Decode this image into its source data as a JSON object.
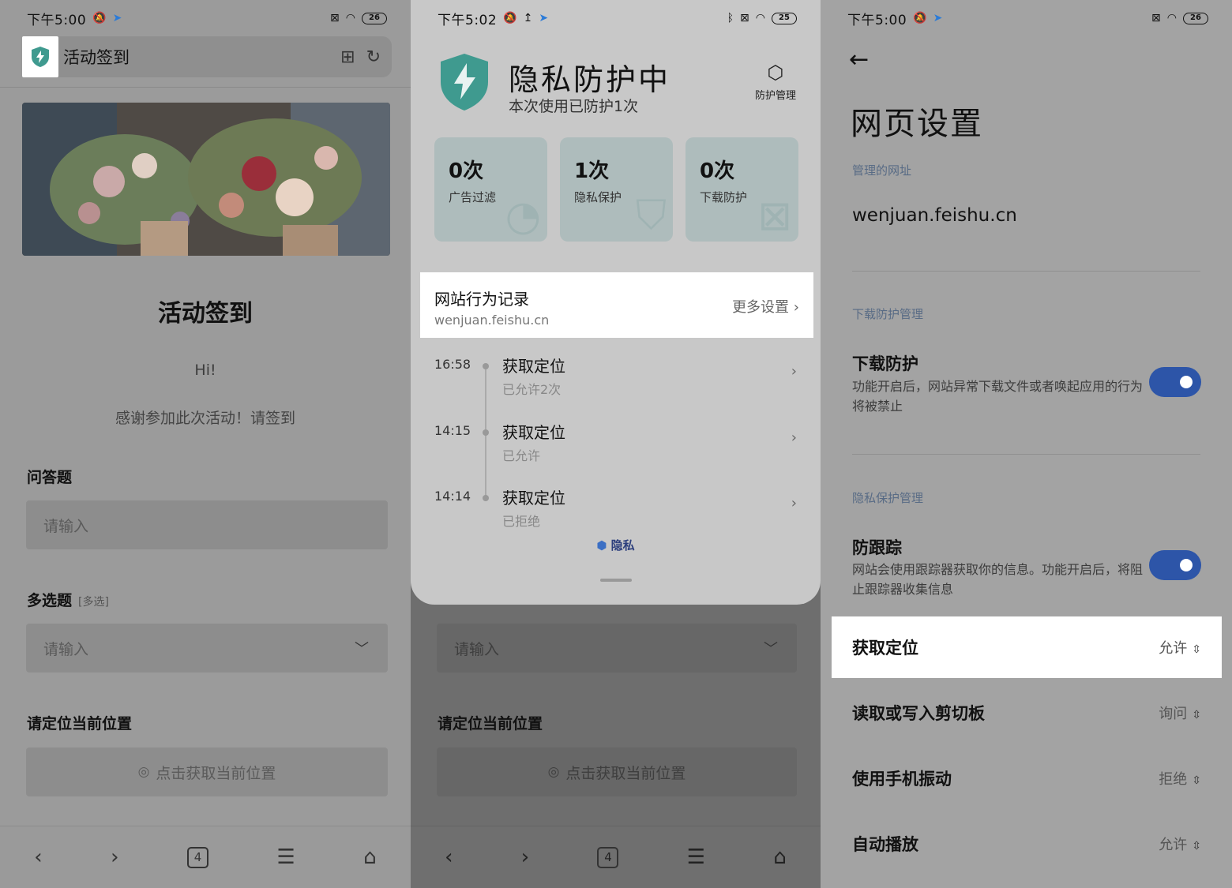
{
  "panel1": {
    "status": {
      "time": "下午5:00",
      "battery": "26"
    },
    "url_title": "活动签到",
    "heading": "活动签到",
    "greeting": "Hi!",
    "thanks": "感谢参加此次活动！请签到",
    "q1_label": "问答题",
    "q1_placeholder": "请输入",
    "q2_label": "多选题",
    "q2_tag": "[多选]",
    "q2_placeholder": "请输入",
    "q3_label": "请定位当前位置",
    "q3_button": "点击获取当前位置",
    "tab_count": "4"
  },
  "panel2": {
    "status": {
      "time": "下午5:02",
      "battery": "25"
    },
    "title": "隐私防护中",
    "subtitle": "本次使用已防护1次",
    "manage": "防护管理",
    "stats": [
      {
        "num": "0次",
        "label": "广告过滤"
      },
      {
        "num": "1次",
        "label": "隐私保护"
      },
      {
        "num": "0次",
        "label": "下载防护"
      }
    ],
    "record_title": "网站行为记录",
    "record_url": "wenjuan.feishu.cn",
    "record_more": "更多设置",
    "records": [
      {
        "time": "16:58",
        "name": "获取定位",
        "status": "已允许2次"
      },
      {
        "time": "14:15",
        "name": "获取定位",
        "status": "已允许"
      },
      {
        "time": "14:14",
        "name": "获取定位",
        "status": "已拒绝"
      }
    ],
    "brand": "隐私",
    "bg_q2_placeholder": "请输入",
    "bg_q3_label": "请定位当前位置",
    "bg_q3_button": "点击获取当前位置",
    "tab_count": "4"
  },
  "panel3": {
    "status": {
      "time": "下午5:00",
      "battery": "26"
    },
    "title": "网页设置",
    "managed_url_label": "管理的网址",
    "managed_url": "wenjuan.feishu.cn",
    "download_section": "下载防护管理",
    "download_title": "下载防护",
    "download_desc": "功能开启后，网站异常下载文件或者唤起应用的行为将被禁止",
    "privacy_section": "隐私保护管理",
    "tracking_title": "防跟踪",
    "tracking_desc": "网站会使用跟踪器获取你的信息。功能开启后，将阻止跟踪器收集信息",
    "permissions": [
      {
        "name": "获取定位",
        "value": "允许"
      },
      {
        "name": "读取或写入剪切板",
        "value": "询问"
      },
      {
        "name": "使用手机振动",
        "value": "拒绝"
      },
      {
        "name": "自动播放",
        "value": "允许"
      }
    ]
  },
  "colors": {
    "shield": "#3f9a8f",
    "toggle": "#2d55a8",
    "section": "#586b85"
  }
}
